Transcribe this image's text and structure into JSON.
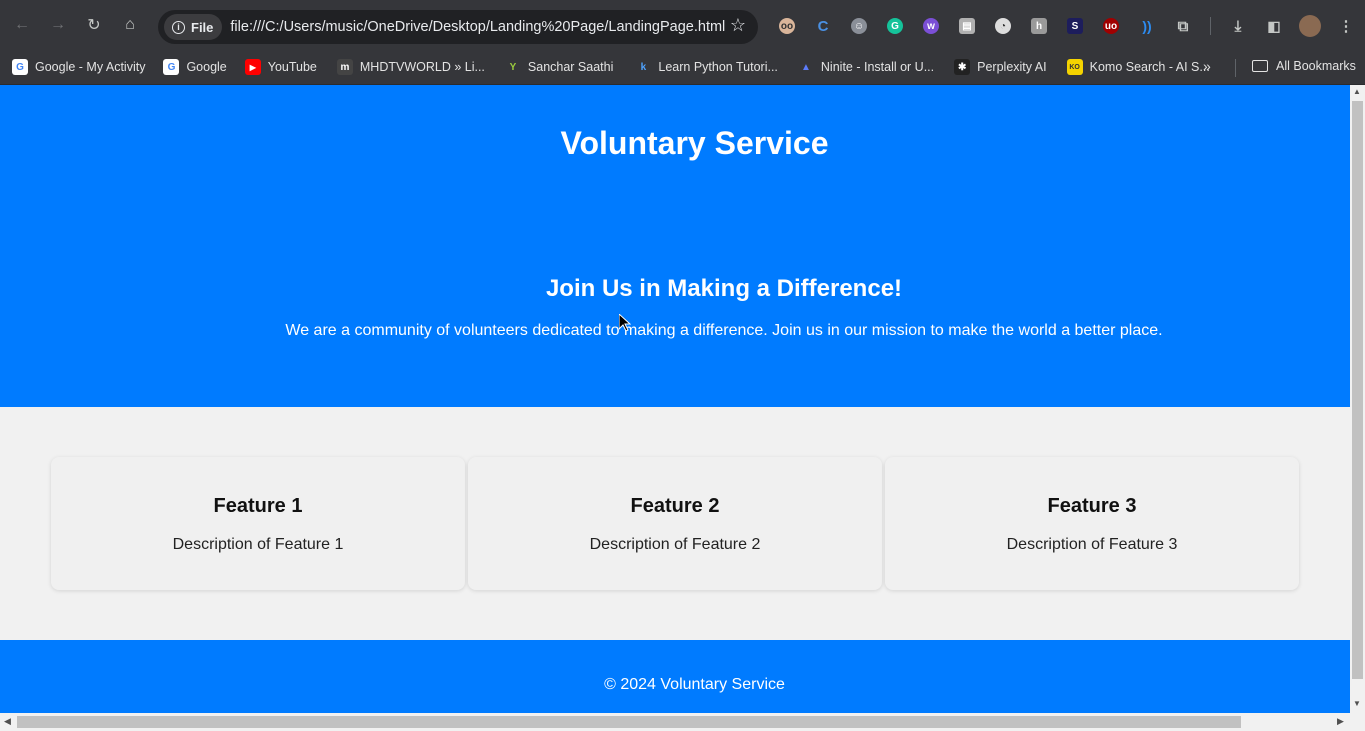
{
  "browser": {
    "chip_label": "File",
    "url": "file:///C:/Users/music/OneDrive/Desktop/Landing%20Page/LandingPage.html",
    "bookmarks": [
      {
        "label": "Google - My Activity",
        "color": "#ffffff",
        "glyph": "G"
      },
      {
        "label": "Google",
        "color": "#ffffff",
        "glyph": "G"
      },
      {
        "label": "YouTube",
        "color": "#ff0000",
        "glyph": "▶"
      },
      {
        "label": "MHDTVWORLD » Li...",
        "color": "#444444",
        "glyph": "m"
      },
      {
        "label": "Sanchar Saathi",
        "color": "#3a6b1f",
        "glyph": "Y"
      },
      {
        "label": "Learn Python Tutori...",
        "color": "#1a73e8",
        "glyph": "k"
      },
      {
        "label": "Ninite - Install or U...",
        "color": "#3b5bdb",
        "glyph": "▲"
      },
      {
        "label": "Perplexity AI",
        "color": "#222222",
        "glyph": "✱"
      },
      {
        "label": "Komo Search - AI S...",
        "color": "#f5d400",
        "glyph": "K"
      }
    ],
    "all_bookmarks_label": "All Bookmarks"
  },
  "page": {
    "site_title": "Voluntary Service",
    "hero_heading": "Join Us in Making a Difference!",
    "hero_text": "We are a community of volunteers dedicated to making a difference. Join us in our mission to make the world a better place.",
    "features": [
      {
        "title": "Feature 1",
        "description": "Description of Feature 1"
      },
      {
        "title": "Feature 2",
        "description": "Description of Feature 2"
      },
      {
        "title": "Feature 3",
        "description": "Description of Feature 3"
      }
    ],
    "footer_text": "© 2024 Voluntary Service"
  },
  "colors": {
    "brand_blue": "#007bff",
    "page_background": "#f1f1f1"
  }
}
